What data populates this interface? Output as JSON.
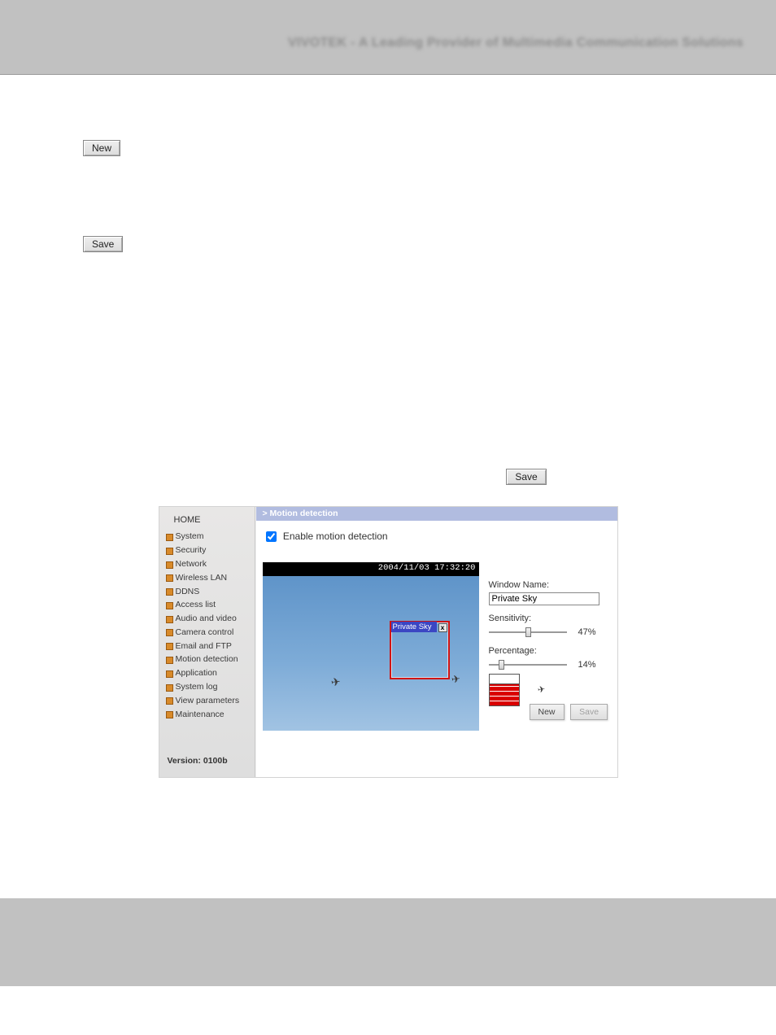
{
  "header_blur": "VIVOTEK - A Leading Provider of Multimedia Communication Solutions",
  "buttons": {
    "new": "New",
    "save": "Save",
    "save_inline": "Save"
  },
  "figure": {
    "section_title": "> Motion detection",
    "enable_label": "Enable motion detection",
    "timestamp": "2004/11/03 17:32:20",
    "window_box_title": "Private Sky",
    "sidebar_home": "HOME",
    "sidebar_items": [
      "System",
      "Security",
      "Network",
      "Wireless LAN",
      "DDNS",
      "Access list",
      "Audio and video",
      "Camera control",
      "Email and FTP",
      "Motion detection",
      "Application",
      "System log",
      "View parameters",
      "Maintenance"
    ],
    "version": "Version: 0100b",
    "controls": {
      "window_name_label": "Window Name:",
      "window_name_value": "Private Sky",
      "sensitivity_label": "Sensitivity:",
      "sensitivity_value": "47%",
      "percentage_label": "Percentage:",
      "percentage_value": "14%",
      "btn_new": "New",
      "btn_save": "Save"
    }
  }
}
